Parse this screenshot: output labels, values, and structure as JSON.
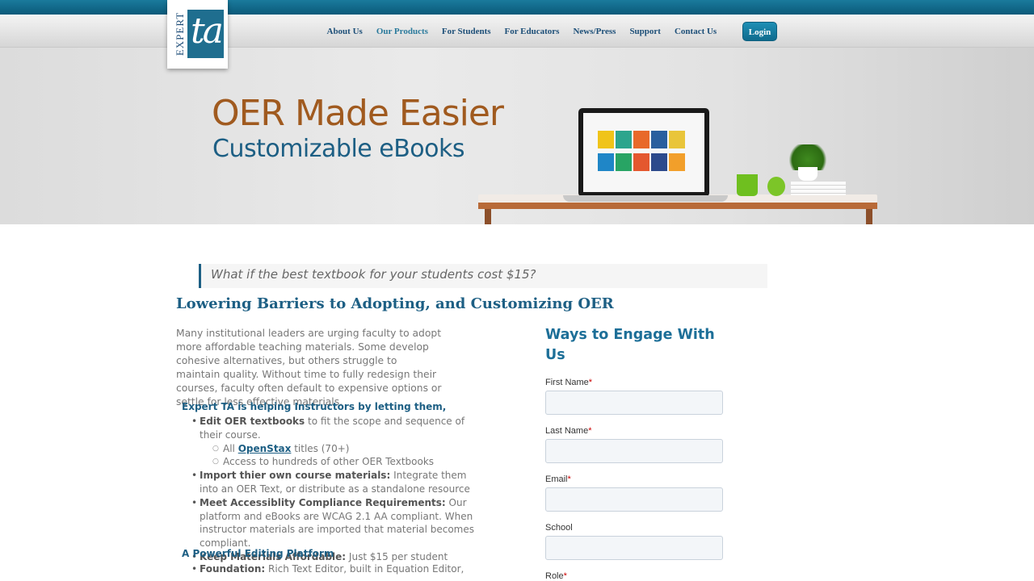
{
  "header": {
    "logo_word": "EXPERT",
    "logo_mark": "ta",
    "nav": [
      "About Us",
      "Our Products",
      "For Students",
      "For Educators",
      "News/Press",
      "Support",
      "Contact Us"
    ],
    "login_label": "Login"
  },
  "hero": {
    "title": "OER Made Easier",
    "subtitle": "Customizable eBooks"
  },
  "content": {
    "quote": "What if the best textbook for your students cost $15?",
    "heading": "Lowering Barriers to Adopting, and Customizing OER",
    "intro": "Many institutional leaders are urging faculty to adopt more affordable teaching materials. Some develop cohesive alternatives, but others struggle to maintain quality. Without time to fully redesign their courses, faculty often default to expensive options or settle for less effective materials.",
    "subhead1": "Expert TA is helping Instructors by letting them,",
    "items": {
      "edit_bold": "Edit OER textbooks",
      "edit_rest": " to fit the scope and sequence of their course.",
      "sub_all_prefix": "All ",
      "sub_all_link": "OpenStax",
      "sub_all_suffix": " titles (70+)",
      "sub_access": "Access to hundreds of other OER Textbooks",
      "import_bold": "Import thier own course materials:",
      "import_rest": " Integrate them into an OER Text, or distribute as a standalone resource",
      "access_bold": "Meet Accessiblity Compliance Requirements:",
      "access_rest": " Our platform and eBooks are WCAG 2.1 AA compliant. When instructor materials are imported that material becomes compliant.",
      "afford_bold": "Keep Materials Affordable:",
      "afford_rest": " Just $15 per student"
    },
    "subhead2": "A Powerful Editing Platform",
    "foundation_bold": "Foundation:",
    "foundation_rest": " Rich Text Editor, built in Equation Editor,"
  },
  "form": {
    "title": "Ways to Engage With Us",
    "first_name": "First Name",
    "last_name": "Last Name",
    "email": "Email",
    "school": "School",
    "role": "Role",
    "required_mark": "*"
  }
}
